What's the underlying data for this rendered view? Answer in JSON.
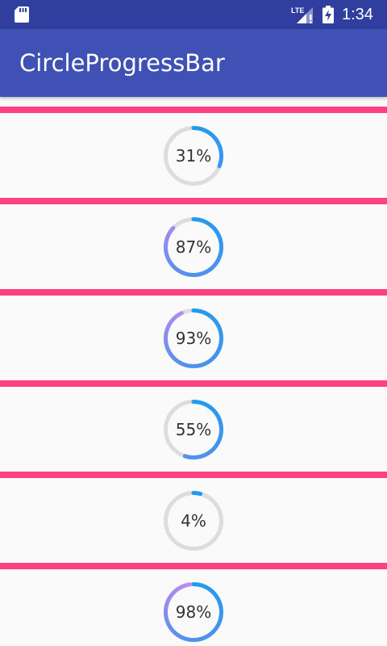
{
  "status_bar": {
    "time": "1:34",
    "network": "LTE"
  },
  "app_bar": {
    "title": "CircleProgressBar"
  },
  "colors": {
    "status_bar": "#303F9F",
    "app_bar": "#3F51B5",
    "divider": "#FF4081",
    "track": "#DDDDDD",
    "gradient_start": "#1E9BF0",
    "gradient_mid": "#5C8FEE",
    "gradient_end": "#C68BEE"
  },
  "progress_items": [
    {
      "value": 31,
      "label": "31%"
    },
    {
      "value": 87,
      "label": "87%"
    },
    {
      "value": 93,
      "label": "93%"
    },
    {
      "value": 55,
      "label": "55%"
    },
    {
      "value": 4,
      "label": "4%"
    },
    {
      "value": 98,
      "label": "98%"
    }
  ]
}
